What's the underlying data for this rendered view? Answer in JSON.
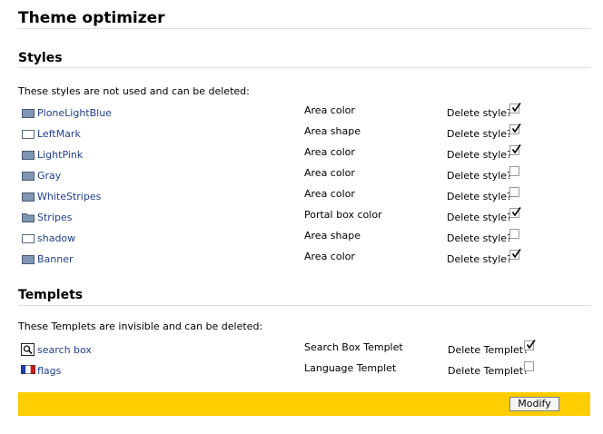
{
  "page": {
    "title": "Theme optimizer"
  },
  "styles": {
    "heading": "Styles",
    "intro": "These styles are not used and can be deleted:",
    "items": [
      {
        "name": "PloneLightBlue",
        "type": "Area color",
        "delete_label": "Delete style?",
        "checked": true,
        "icon": "folder-filled-icon"
      },
      {
        "name": "LeftMark",
        "type": "Area shape",
        "delete_label": "Delete style?",
        "checked": true,
        "icon": "rectangle-outline-icon"
      },
      {
        "name": "LightPink",
        "type": "Area color",
        "delete_label": "Delete style?",
        "checked": true,
        "icon": "folder-filled-icon"
      },
      {
        "name": "Gray",
        "type": "Area color",
        "delete_label": "Delete style?",
        "checked": false,
        "icon": "folder-filled-icon"
      },
      {
        "name": "WhiteStripes",
        "type": "Area color",
        "delete_label": "Delete style?",
        "checked": false,
        "icon": "folder-filled-icon"
      },
      {
        "name": "Stripes",
        "type": "Portal box color",
        "delete_label": "Delete style?",
        "checked": true,
        "icon": "folder-tab-icon"
      },
      {
        "name": "shadow",
        "type": "Area shape",
        "delete_label": "Delete style?",
        "checked": false,
        "icon": "rectangle-outline-icon"
      },
      {
        "name": "Banner",
        "type": "Area color",
        "delete_label": "Delete style?",
        "checked": true,
        "icon": "folder-filled-icon"
      }
    ]
  },
  "templets": {
    "heading": "Templets",
    "intro": "These Templets are invisible and can be deleted:",
    "items": [
      {
        "name": "search box",
        "type": "Search Box Templet",
        "delete_label": "Delete Templet?",
        "checked": true,
        "icon": "magnifier-icon"
      },
      {
        "name": "flags",
        "type": "Language Templet",
        "delete_label": "Delete Templet?",
        "checked": false,
        "icon": "french-flag-icon"
      }
    ]
  },
  "actions": {
    "modify_label": "Modify"
  },
  "colors": {
    "accent_bar": "#ffcd00",
    "link": "#1f3f8f"
  }
}
